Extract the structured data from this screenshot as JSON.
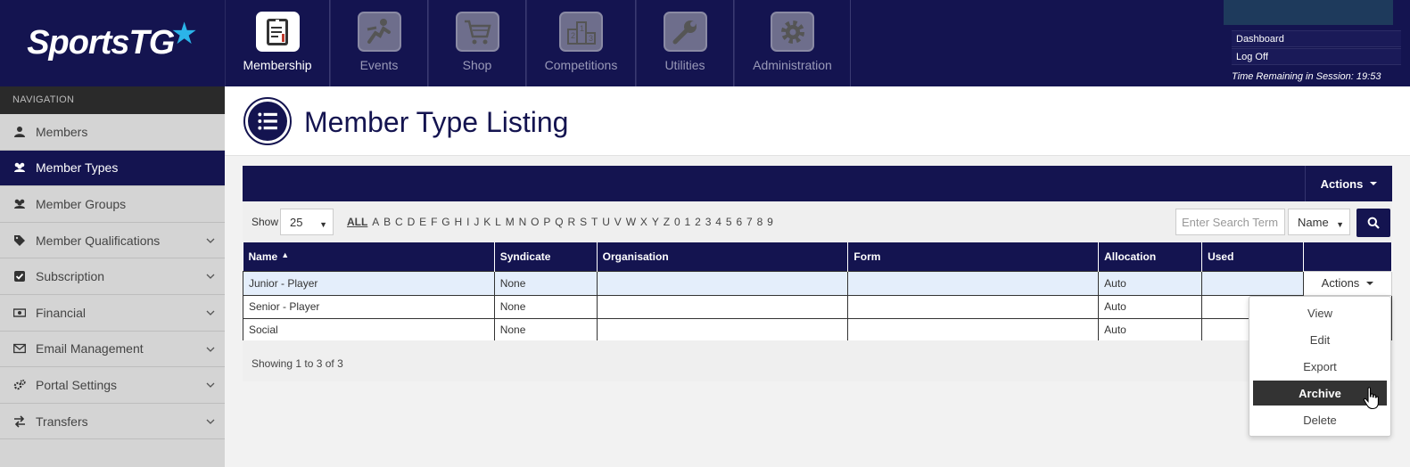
{
  "brand": {
    "name": "SportsTG"
  },
  "modules": [
    {
      "label": "Membership",
      "icon": "membership-icon",
      "active": true
    },
    {
      "label": "Events",
      "icon": "events-icon"
    },
    {
      "label": "Shop",
      "icon": "shop-cart-icon"
    },
    {
      "label": "Competitions",
      "icon": "podium-icon"
    },
    {
      "label": "Utilities",
      "icon": "wrench-icon"
    },
    {
      "label": "Administration",
      "icon": "gear-icon"
    }
  ],
  "session": {
    "dashboard": "Dashboard",
    "logoff": "Log Off",
    "time_remaining": "Time Remaining in Session: 19:53"
  },
  "nav": {
    "heading": "NAVIGATION",
    "items": [
      {
        "label": "Members",
        "icon": "user-icon"
      },
      {
        "label": "Member Types",
        "icon": "users-icon",
        "active": true
      },
      {
        "label": "Member Groups",
        "icon": "users-icon"
      },
      {
        "label": "Member Qualifications",
        "icon": "tags-icon",
        "expandable": true
      },
      {
        "label": "Subscription",
        "icon": "checkbox-icon",
        "expandable": true
      },
      {
        "label": "Financial",
        "icon": "money-icon",
        "expandable": true
      },
      {
        "label": "Email Management",
        "icon": "envelope-icon",
        "expandable": true
      },
      {
        "label": "Portal Settings",
        "icon": "cogs-icon",
        "expandable": true
      },
      {
        "label": "Transfers",
        "icon": "exchange-icon",
        "expandable": true
      }
    ]
  },
  "page": {
    "title": "Member Type Listing"
  },
  "panel": {
    "actions_label": "Actions"
  },
  "controls": {
    "show_label": "Show",
    "page_size": "25",
    "alphabet": [
      "ALL",
      "A",
      "B",
      "C",
      "D",
      "E",
      "F",
      "G",
      "H",
      "I",
      "J",
      "K",
      "L",
      "M",
      "N",
      "O",
      "P",
      "Q",
      "R",
      "S",
      "T",
      "U",
      "V",
      "W",
      "X",
      "Y",
      "Z",
      "0",
      "1",
      "2",
      "3",
      "4",
      "5",
      "6",
      "7",
      "8",
      "9"
    ],
    "search_placeholder": "Enter Search Term",
    "search_field": "Name"
  },
  "table": {
    "columns": [
      "Name",
      "Syndicate",
      "Organisation",
      "Form",
      "Allocation",
      "Used",
      ""
    ],
    "rows": [
      {
        "name": "Junior - Player",
        "syndicate": "None",
        "organisation": "",
        "form": "",
        "allocation": "Auto",
        "used": ""
      },
      {
        "name": "Senior - Player",
        "syndicate": "None",
        "organisation": "",
        "form": "",
        "allocation": "Auto",
        "used": ""
      },
      {
        "name": "Social",
        "syndicate": "None",
        "organisation": "",
        "form": "",
        "allocation": "Auto",
        "used": ""
      }
    ],
    "row_actions_label": "Actions"
  },
  "footer": {
    "info": "Showing 1 to 3 of 3"
  },
  "dropdown": {
    "items": [
      "View",
      "Edit",
      "Export",
      "Archive",
      "Delete"
    ],
    "hovered": "Archive"
  }
}
